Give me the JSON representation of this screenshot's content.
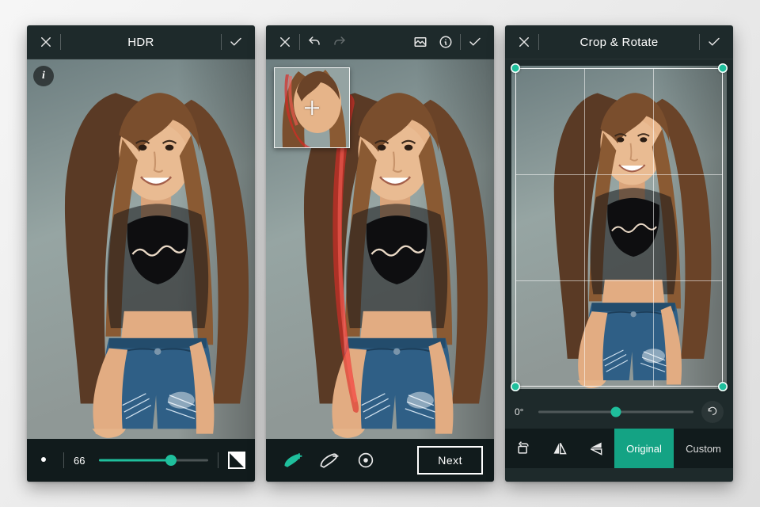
{
  "accent_color": "#1fbf9c",
  "panel1": {
    "title": "HDR",
    "brightness_value": "66",
    "slider_percent": 66
  },
  "panel2": {
    "next_label": "Next"
  },
  "panel3": {
    "title": "Crop & Rotate",
    "angle_label": "0°",
    "angle_percent": 50,
    "tabs": {
      "original": "Original",
      "custom": "Custom"
    }
  }
}
